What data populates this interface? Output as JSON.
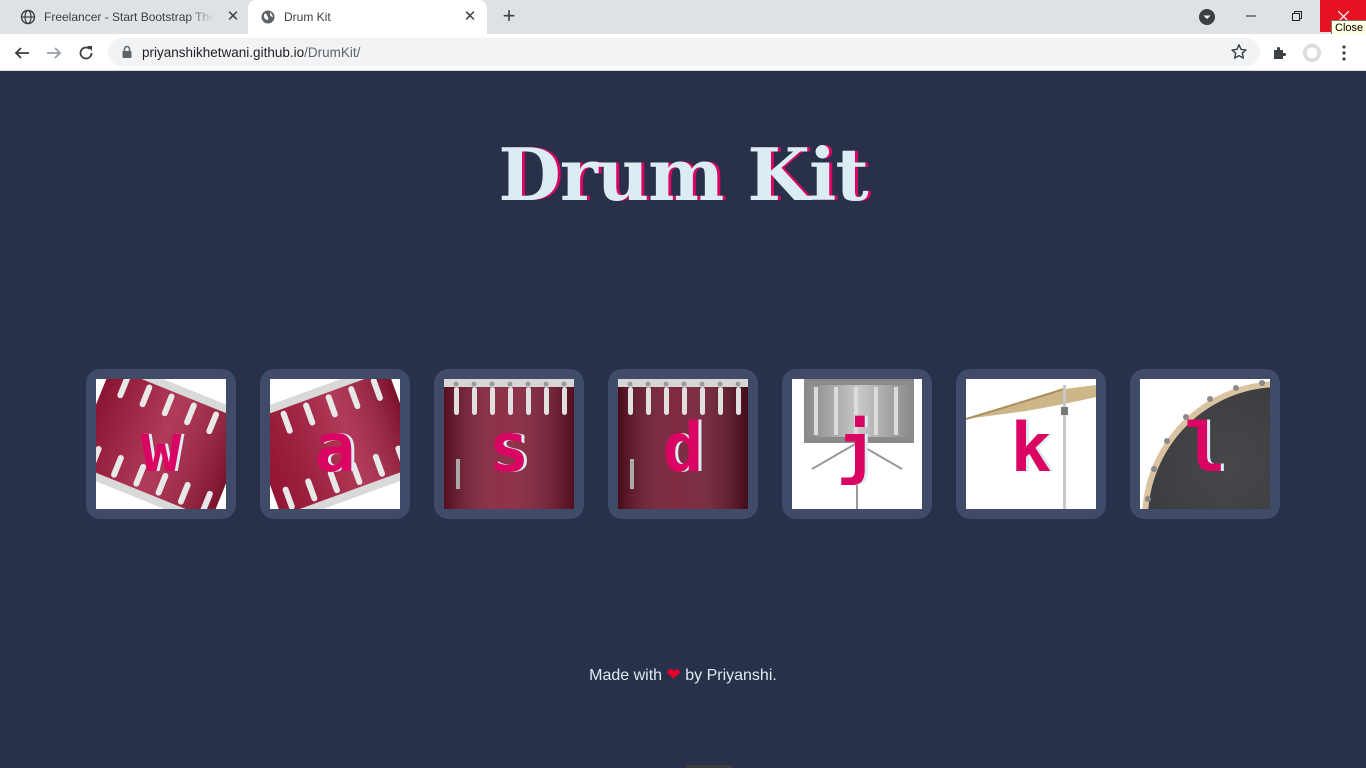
{
  "browser": {
    "tabs": [
      {
        "title": "Freelancer - Start Bootstrap Theme",
        "icon": "globe-icon"
      },
      {
        "title": "Drum Kit",
        "icon": "globe-icon",
        "active": true
      }
    ],
    "url_host": "priyanshikhetwani.github.io",
    "url_path": "/DrumKit/",
    "close_tooltip": "Close"
  },
  "page": {
    "heading": "Drum Kit",
    "drums": [
      {
        "key": "w",
        "kind": "tom-1"
      },
      {
        "key": "a",
        "kind": "tom-2"
      },
      {
        "key": "s",
        "kind": "tom-3"
      },
      {
        "key": "d",
        "kind": "tom-4"
      },
      {
        "key": "j",
        "kind": "snare"
      },
      {
        "key": "k",
        "kind": "crash"
      },
      {
        "key": "l",
        "kind": "kick"
      }
    ],
    "footer": {
      "before": "Made with",
      "heart": "❤",
      "after": "by Priyanshi."
    }
  },
  "colors": {
    "background": "#283149",
    "title": "#dbedf3",
    "accent": "#da0463",
    "tile": "#404b69"
  }
}
